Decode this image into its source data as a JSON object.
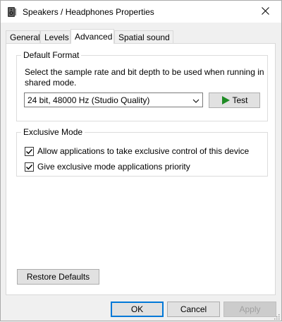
{
  "window": {
    "title": "Speakers / Headphones Properties",
    "icon": "speaker-icon",
    "close_icon": "close-icon"
  },
  "tabs": [
    {
      "label": "General",
      "active": false
    },
    {
      "label": "Levels",
      "active": false
    },
    {
      "label": "Advanced",
      "active": true
    },
    {
      "label": "Spatial sound",
      "active": false
    }
  ],
  "default_format": {
    "legend": "Default Format",
    "description": "Select the sample rate and bit depth to be used when running in shared mode.",
    "selected_format": "24 bit, 48000 Hz (Studio Quality)",
    "test_button_label": "Test",
    "test_icon": "play-icon"
  },
  "exclusive_mode": {
    "legend": "Exclusive Mode",
    "options": [
      {
        "label": "Allow applications to take exclusive control of this device",
        "checked": true
      },
      {
        "label": "Give exclusive mode applications priority",
        "checked": true
      }
    ]
  },
  "restore_defaults_label": "Restore Defaults",
  "footer": {
    "ok_label": "OK",
    "cancel_label": "Cancel",
    "apply_label": "Apply"
  },
  "colors": {
    "accent": "#0078d7",
    "play_green": "#1e8b24",
    "window_bg": "#f0f0f0"
  }
}
